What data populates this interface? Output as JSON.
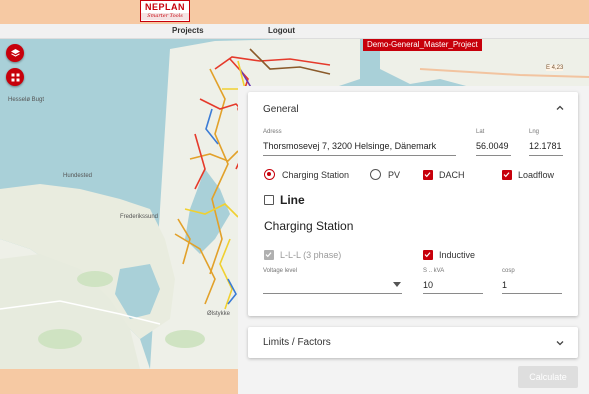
{
  "logo": {
    "brand": "NEPLAN",
    "tagline": "Smarter Tools"
  },
  "nav": {
    "projects": "Projects",
    "logout": "Logout"
  },
  "project_badge": "Demo-General_Master_Project",
  "map": {
    "labels": {
      "hessle_bugt": "Hesselø Bugt",
      "hundested": "Hundested",
      "frederikssund": "Frederikssund",
      "road_sign": "E 4,23",
      "olstykke": "Ølstykke"
    },
    "controls": [
      {
        "icon": "layers-icon"
      },
      {
        "icon": "grid-icon"
      }
    ]
  },
  "general": {
    "title": "General",
    "adress_label": "Adress",
    "adress_value": "Thorsmosevej 7, 3200 Helsinge, Dänemark",
    "lat_label": "Lat",
    "lat_value": "56.0049",
    "lng_label": "Lng",
    "lng_value": "12.1781",
    "options": {
      "charging_station": "Charging Station",
      "pv": "PV",
      "dach": "DACH",
      "loadflow": "Loadflow"
    },
    "line_label": "Line",
    "section_title": "Charging Station",
    "phase_label": "L-L-L (3 phase)",
    "inductive_label": "Inductive",
    "voltage_label": "Voltage level",
    "voltage_value": "",
    "s_label": "S .. kVA",
    "s_value": "10",
    "cosp_label": "cosp",
    "cosp_value": "1"
  },
  "limits": {
    "title": "Limits / Factors"
  },
  "calculate_label": "Calculate",
  "colors": {
    "accent": "#c7000b",
    "header": "#f6c9a3",
    "water": "#a9d0d8",
    "land": "#eef0e8"
  }
}
